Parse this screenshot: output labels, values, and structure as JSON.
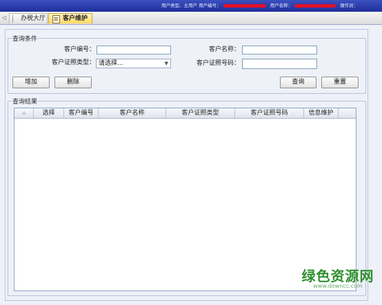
{
  "topbar": {
    "prefix_text": "用户类型、主用户",
    "user_id_label": "用户编号：",
    "user_name_label": "用户名称：",
    "action_label": "操作员："
  },
  "tabs": [
    {
      "label": "办税大厅",
      "active": false
    },
    {
      "label": "客户维护",
      "active": true
    }
  ],
  "query_group": {
    "legend": "查询条件",
    "customer_no_label": "客户编号：",
    "customer_no_value": "",
    "customer_name_label": "客户名称：",
    "customer_name_value": "",
    "id_type_label": "客户证照类型：",
    "id_type_selected": "请选择...",
    "id_no_label": "客户证照号码：",
    "id_no_value": ""
  },
  "buttons": {
    "add": "增加",
    "delete": "删除",
    "query": "查询",
    "reset": "重置"
  },
  "result_group": {
    "legend": "查询结果",
    "columns": [
      "选择",
      "客户编号",
      "客户名称",
      "客户证照类型",
      "客户证照号码",
      "信息维护"
    ],
    "rows": []
  },
  "watermark": {
    "title": "绿色资源网",
    "url": "www.downcc.com"
  },
  "colors": {
    "topbar": "#2a3cb0",
    "redaction": "#e0102a",
    "active_tab": "#ffd95e",
    "watermark": "#2f8f2f"
  }
}
